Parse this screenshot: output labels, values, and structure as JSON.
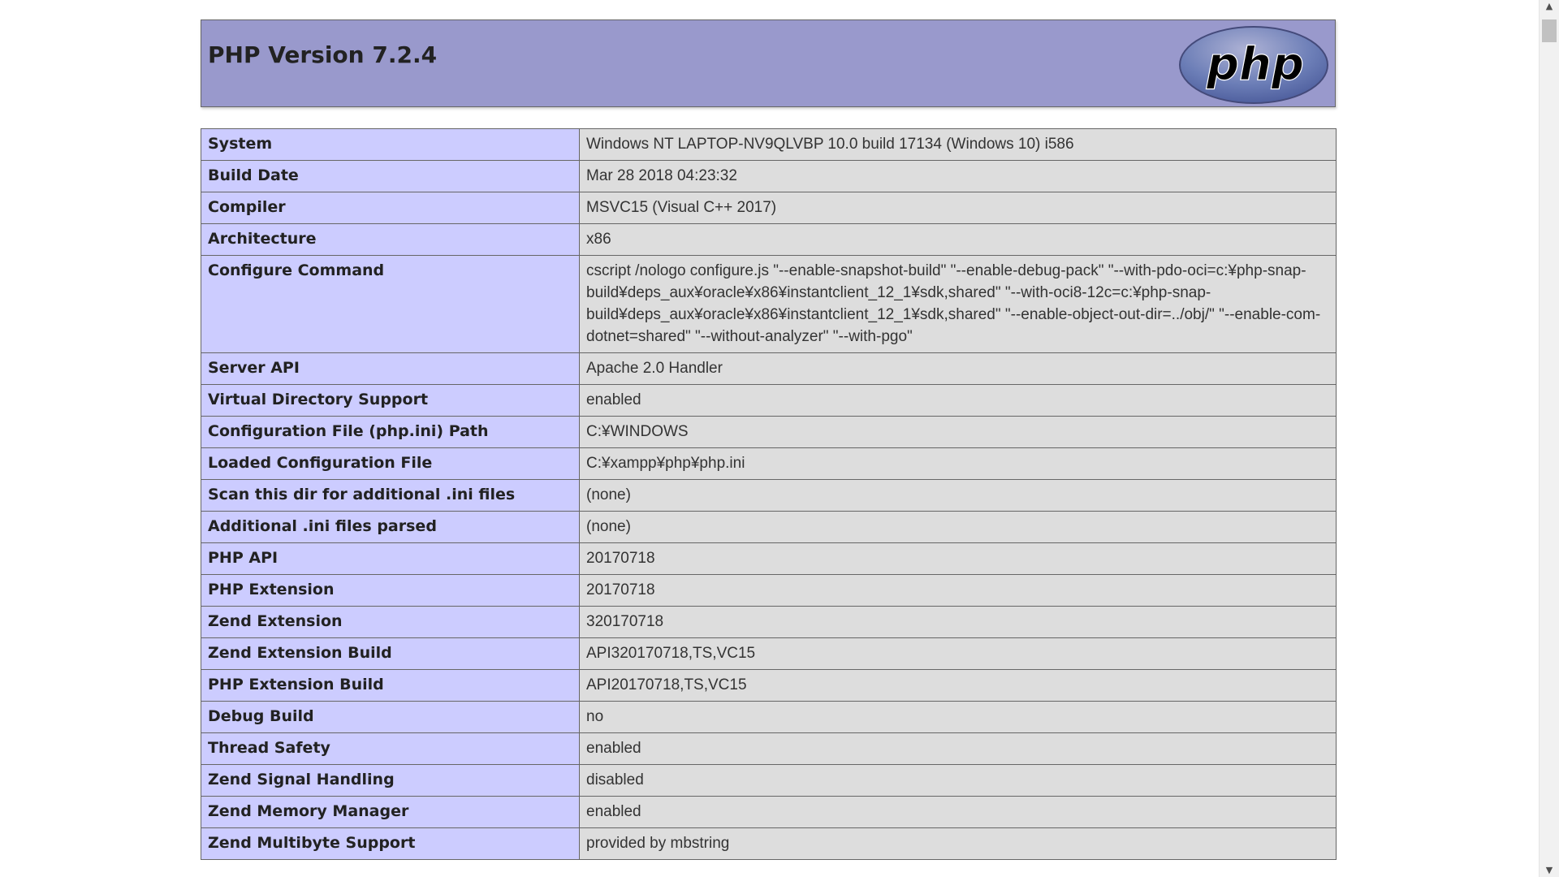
{
  "header": {
    "title": "PHP Version 7.2.4",
    "logo_text": "php",
    "colors": {
      "header_bg": "#9999cc",
      "label_bg": "#ccccff",
      "value_bg": "#dddddd",
      "logo_bg": "#6c7eb7",
      "logo_text": "#000000"
    }
  },
  "info_rows": [
    {
      "label": "System",
      "value": "Windows NT LAPTOP-NV9QLVBP 10.0 build 17134 (Windows 10) i586"
    },
    {
      "label": "Build Date",
      "value": "Mar 28 2018 04:23:32"
    },
    {
      "label": "Compiler",
      "value": "MSVC15 (Visual C++ 2017)"
    },
    {
      "label": "Architecture",
      "value": "x86"
    },
    {
      "label": "Configure Command",
      "value": "cscript /nologo configure.js \"--enable-snapshot-build\" \"--enable-debug-pack\" \"--with-pdo-oci=c:¥php-snap-build¥deps_aux¥oracle¥x86¥instantclient_12_1¥sdk,shared\" \"--with-oci8-12c=c:¥php-snap-build¥deps_aux¥oracle¥x86¥instantclient_12_1¥sdk,shared\" \"--enable-object-out-dir=../obj/\" \"--enable-com-dotnet=shared\" \"--without-analyzer\" \"--with-pgo\""
    },
    {
      "label": "Server API",
      "value": "Apache 2.0 Handler"
    },
    {
      "label": "Virtual Directory Support",
      "value": "enabled"
    },
    {
      "label": "Configuration File (php.ini) Path",
      "value": "C:¥WINDOWS"
    },
    {
      "label": "Loaded Configuration File",
      "value": "C:¥xampp¥php¥php.ini"
    },
    {
      "label": "Scan this dir for additional .ini files",
      "value": "(none)"
    },
    {
      "label": "Additional .ini files parsed",
      "value": "(none)"
    },
    {
      "label": "PHP API",
      "value": "20170718"
    },
    {
      "label": "PHP Extension",
      "value": "20170718"
    },
    {
      "label": "Zend Extension",
      "value": "320170718"
    },
    {
      "label": "Zend Extension Build",
      "value": "API320170718,TS,VC15"
    },
    {
      "label": "PHP Extension Build",
      "value": "API20170718,TS,VC15"
    },
    {
      "label": "Debug Build",
      "value": "no"
    },
    {
      "label": "Thread Safety",
      "value": "enabled"
    },
    {
      "label": "Zend Signal Handling",
      "value": "disabled"
    },
    {
      "label": "Zend Memory Manager",
      "value": "enabled"
    },
    {
      "label": "Zend Multibyte Support",
      "value": "provided by mbstring"
    }
  ],
  "scrollbar": {
    "up_icon": "scroll-up-arrow-icon",
    "down_icon": "scroll-down-arrow-icon"
  }
}
